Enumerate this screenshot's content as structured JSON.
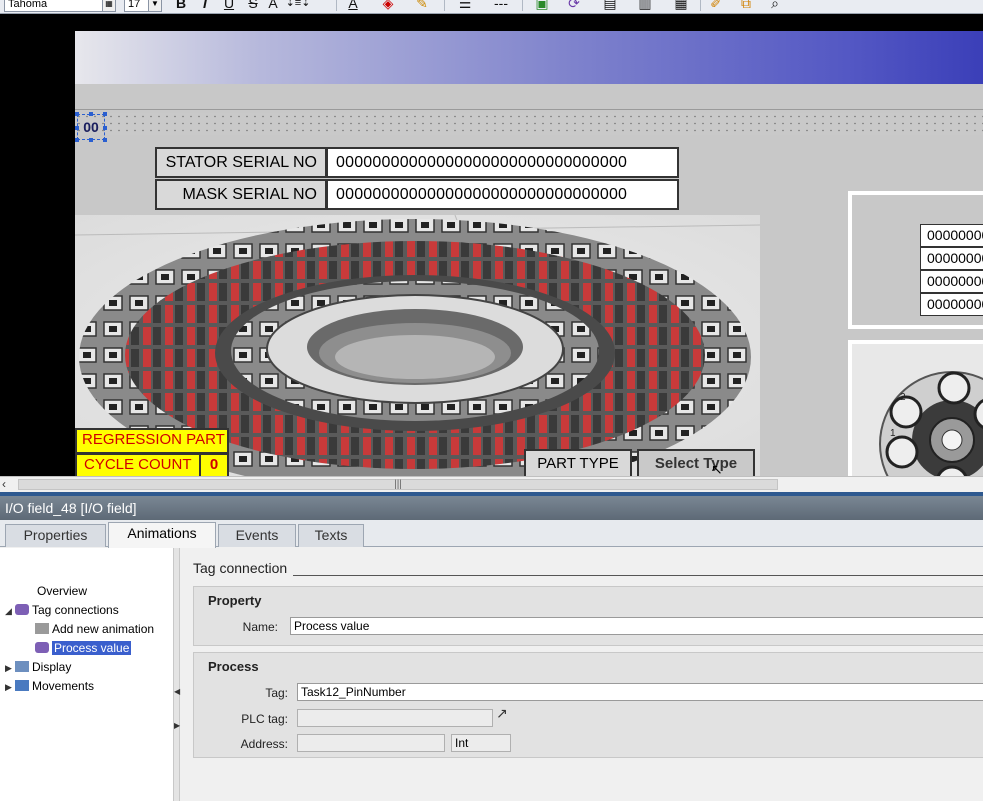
{
  "toolbar": {
    "font_name": "Tahoma",
    "font_size": "17",
    "buttons": [
      "B",
      "I",
      "U",
      "S",
      "A",
      "A",
      "⇩",
      "✎",
      "≡",
      "---"
    ]
  },
  "canvas": {
    "selected_field_text": "00",
    "stator_label": "STATOR SERIAL NO",
    "stator_value": "00000000000000000000000000000000",
    "mask_label": "MASK SERIAL NO",
    "mask_value": "00000000000000000000000000000000",
    "regression_label": "REGRESSION PART",
    "cycle_count_label": "CYCLE COUNT",
    "cycle_count_value": "0",
    "part_type_label": "PART TYPE",
    "select_type_button": "Select Type",
    "right_panel_values": [
      "00000000",
      "00000000",
      "00000000",
      "00000000"
    ],
    "knob_numbers": [
      "1",
      "2"
    ]
  },
  "inspector": {
    "title": "I/O field_48 [I/O field]",
    "tabs": [
      "Properties",
      "Animations",
      "Events",
      "Texts"
    ],
    "active_tab": "Animations",
    "tree": {
      "overview": "Overview",
      "tag_connections": "Tag connections",
      "add_new_animation": "Add new animation",
      "process_value": "Process value",
      "display": "Display",
      "movements": "Movements"
    },
    "section_heading": "Tag connection",
    "property": {
      "title": "Property",
      "name_label": "Name:",
      "name_value": "Process value"
    },
    "process": {
      "title": "Process",
      "tag_label": "Tag:",
      "tag_value": "Task12_PinNumber",
      "plc_tag_label": "PLC tag:",
      "plc_tag_value": "",
      "address_label": "Address:",
      "address_value": "",
      "address_type": "Int"
    }
  },
  "colors": {
    "selection": "#3a5fcd",
    "yellow_indicator": "#ffff00",
    "red_text": "#d00000",
    "header_blue": "#3b3fb8",
    "divider_blue": "#2e5990"
  }
}
